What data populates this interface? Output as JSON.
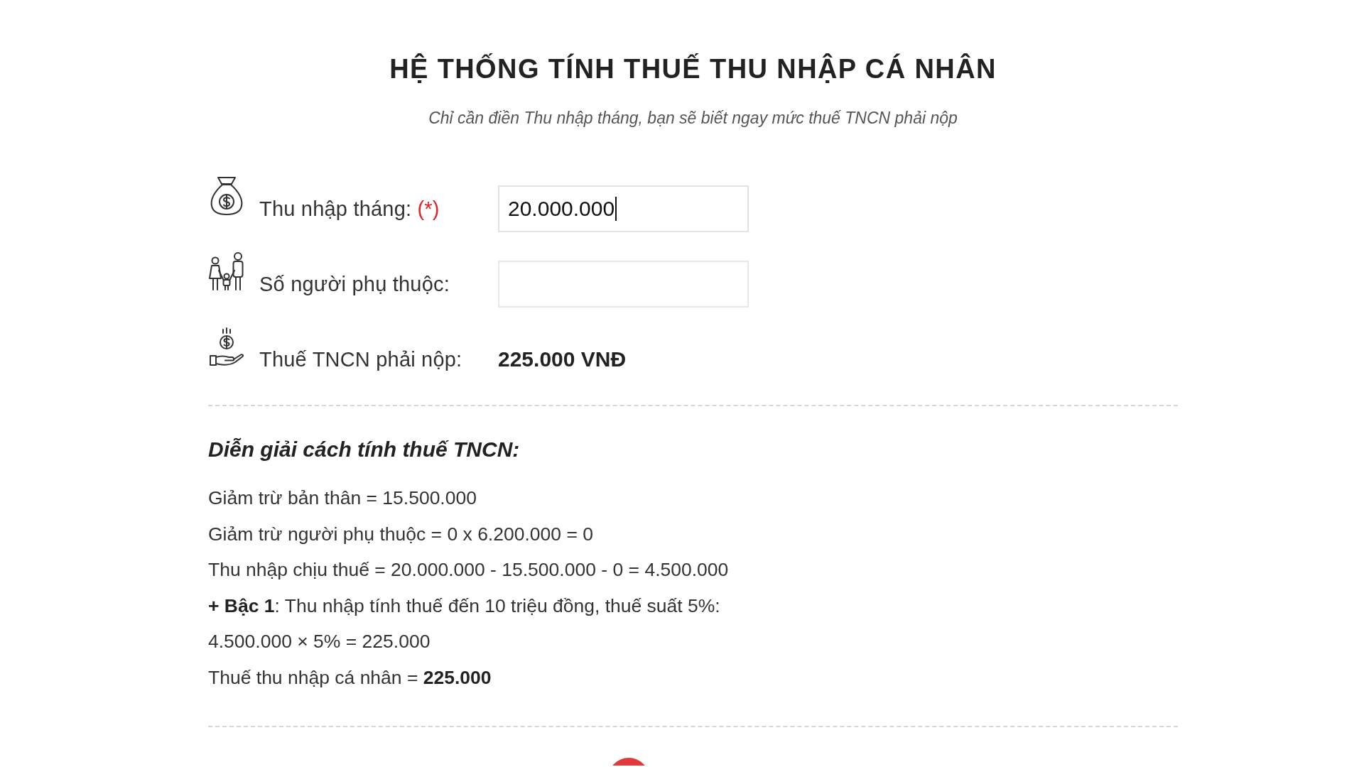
{
  "title": "HỆ THỐNG TÍNH THUẾ THU NHẬP CÁ NHÂN",
  "subtitle": "Chỉ cần điền Thu nhập tháng, bạn sẽ biết ngay mức thuế TNCN phải nộp",
  "form": {
    "rows": [
      {
        "kind": "input",
        "label": "Thu nhập tháng:",
        "required_mark": "(*)",
        "value": "20.000.000",
        "focused": true
      },
      {
        "kind": "input",
        "label": "Số người phụ thuộc:",
        "focused": false
      },
      {
        "kind": "result",
        "label": "Thuế TNCN phải nộp:",
        "value": "225.000 VNĐ"
      }
    ]
  },
  "explanation": {
    "heading": "Diễn giải cách tính thuế TNCN:",
    "lines": [
      "Giảm trừ bản thân = 15.500.000",
      "Giảm trừ người phụ thuộc = 0 x 6.200.000 = 0",
      "Thu nhập chịu thuế = 20.000.000 - 15.500.000 - 0 = 4.500.000",
      "**+ Bậc 1**: Thu nhập tính thuế đến 10 triệu đồng, thuế suất 5%:",
      "4.500.000 × 5% = 225.000",
      "Thuế thu nhập cá nhân = **225.000**"
    ]
  }
}
